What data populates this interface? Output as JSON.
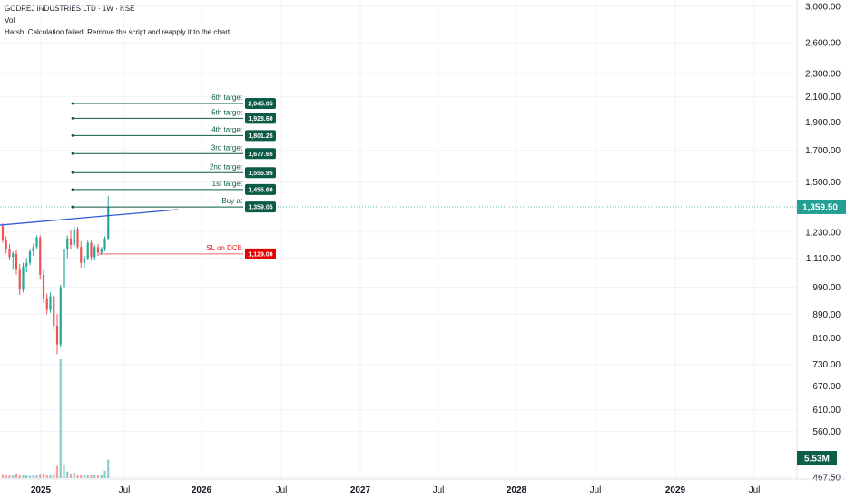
{
  "legend": {
    "title": "GODREJ INDUSTRIES LTD · 1W · NSE",
    "vol": "Vol",
    "error": "Harsh: Calculation failed. Remove the script and reapply it to the chart."
  },
  "chart_data": {
    "type": "candlestick",
    "y_axis_ticks": [
      "3,000.00",
      "2,600.00",
      "2,300.00",
      "2,100.00",
      "1,900.00",
      "1,700.00",
      "1,500.00",
      "1,230.00",
      "1,110.00",
      "990.00",
      "890.00",
      "810.00",
      "730.00",
      "670.00",
      "610.00",
      "560.00",
      "467.50"
    ],
    "y_axis_scale": "log",
    "x_axis_ticks": [
      {
        "label": "2025",
        "bold": true
      },
      {
        "label": "Jul",
        "bold": false
      },
      {
        "label": "2026",
        "bold": true
      },
      {
        "label": "Jul",
        "bold": false
      },
      {
        "label": "2027",
        "bold": true
      },
      {
        "label": "Jul",
        "bold": false
      },
      {
        "label": "2028",
        "bold": true
      },
      {
        "label": "Jul",
        "bold": false
      },
      {
        "label": "2029",
        "bold": true
      },
      {
        "label": "Jul",
        "bold": false
      }
    ],
    "current_price": "1,359.50",
    "current_volume": "5.53M",
    "targets": [
      {
        "name": "6th target",
        "value": "2,045.05"
      },
      {
        "name": "5th target",
        "value": "1,928.60"
      },
      {
        "name": "4th target",
        "value": "1,801.25"
      },
      {
        "name": "3rd target",
        "value": "1,677.65"
      },
      {
        "name": "2nd target",
        "value": "1,555.95"
      },
      {
        "name": "1st target",
        "value": "1,455.60"
      },
      {
        "name": "Buy at",
        "value": "1,359.05"
      }
    ],
    "stop_loss": {
      "name": "SL on DCB",
      "value": "1,129.00"
    },
    "trendline": {
      "start_price": 1265,
      "end_price": 1345
    },
    "candles": [
      {
        "o": 1260,
        "h": 1275,
        "l": 1180,
        "c": 1190
      },
      {
        "o": 1190,
        "h": 1210,
        "l": 1130,
        "c": 1150
      },
      {
        "o": 1150,
        "h": 1175,
        "l": 1100,
        "c": 1115
      },
      {
        "o": 1115,
        "h": 1140,
        "l": 1060,
        "c": 1130
      },
      {
        "o": 1130,
        "h": 1145,
        "l": 1040,
        "c": 1060
      },
      {
        "o": 1060,
        "h": 1085,
        "l": 960,
        "c": 980
      },
      {
        "o": 980,
        "h": 1090,
        "l": 970,
        "c": 1075
      },
      {
        "o": 1075,
        "h": 1110,
        "l": 1050,
        "c": 1090
      },
      {
        "o": 1090,
        "h": 1150,
        "l": 1080,
        "c": 1140
      },
      {
        "o": 1140,
        "h": 1175,
        "l": 1120,
        "c": 1160
      },
      {
        "o": 1160,
        "h": 1215,
        "l": 1150,
        "c": 1205
      },
      {
        "o": 1205,
        "h": 1215,
        "l": 1020,
        "c": 1040
      },
      {
        "o": 1040,
        "h": 1060,
        "l": 930,
        "c": 945
      },
      {
        "o": 945,
        "h": 965,
        "l": 890,
        "c": 905
      },
      {
        "o": 905,
        "h": 970,
        "l": 895,
        "c": 955
      },
      {
        "o": 955,
        "h": 960,
        "l": 830,
        "c": 850
      },
      {
        "o": 850,
        "h": 890,
        "l": 760,
        "c": 790
      },
      {
        "o": 790,
        "h": 1000,
        "l": 780,
        "c": 990
      },
      {
        "o": 990,
        "h": 1160,
        "l": 980,
        "c": 1150
      },
      {
        "o": 1150,
        "h": 1215,
        "l": 1110,
        "c": 1200
      },
      {
        "o": 1200,
        "h": 1240,
        "l": 1150,
        "c": 1170
      },
      {
        "o": 1170,
        "h": 1260,
        "l": 1160,
        "c": 1245
      },
      {
        "o": 1245,
        "h": 1255,
        "l": 1150,
        "c": 1160
      },
      {
        "o": 1160,
        "h": 1185,
        "l": 1070,
        "c": 1090
      },
      {
        "o": 1090,
        "h": 1120,
        "l": 1070,
        "c": 1110
      },
      {
        "o": 1110,
        "h": 1190,
        "l": 1100,
        "c": 1180
      },
      {
        "o": 1180,
        "h": 1190,
        "l": 1100,
        "c": 1115
      },
      {
        "o": 1115,
        "h": 1170,
        "l": 1100,
        "c": 1160
      },
      {
        "o": 1160,
        "h": 1175,
        "l": 1120,
        "c": 1135
      },
      {
        "o": 1135,
        "h": 1160,
        "l": 1125,
        "c": 1150
      },
      {
        "o": 1150,
        "h": 1210,
        "l": 1140,
        "c": 1200
      },
      {
        "o": 1200,
        "h": 1420,
        "l": 1190,
        "c": 1359.5
      }
    ],
    "volumes": [
      1.2,
      0.9,
      1.0,
      0.8,
      1.4,
      0.9,
      1.1,
      0.8,
      0.7,
      0.9,
      1.0,
      1.3,
      1.5,
      1.1,
      0.8,
      1.2,
      3.6,
      35.5,
      4.2,
      2.0,
      1.4,
      1.6,
      1.1,
      1.0,
      1.0,
      0.9,
      1.1,
      0.9,
      0.8,
      1.0,
      2.2,
      5.53
    ],
    "colors": {
      "up": "#26a69a",
      "down": "#ef5350",
      "trendline": "#2f5bd7",
      "target": "#0b5c46",
      "stop": "#e60000",
      "grid": "#f0f3fa"
    }
  }
}
